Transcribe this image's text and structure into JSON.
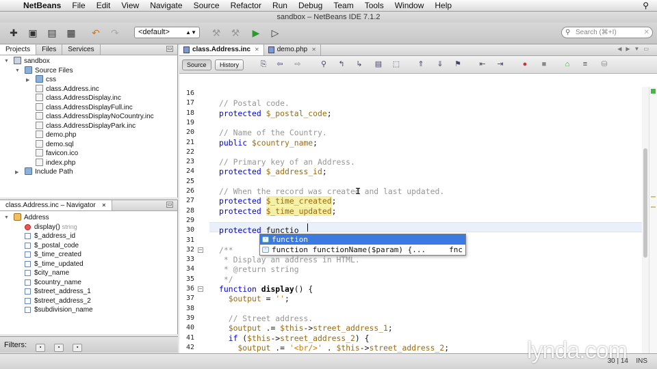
{
  "menubar": {
    "app": "NetBeans",
    "items": [
      "File",
      "Edit",
      "View",
      "Navigate",
      "Source",
      "Refactor",
      "Run",
      "Debug",
      "Team",
      "Tools",
      "Window",
      "Help"
    ]
  },
  "window": {
    "title": "sandbox – NetBeans IDE 7.1.2"
  },
  "toolbar": {
    "config_value": "<default>",
    "search_placeholder": "Search (⌘+I)"
  },
  "projects": {
    "tabs": [
      "Projects",
      "Files",
      "Services"
    ],
    "tree": [
      {
        "label": "sandbox",
        "level": 0,
        "icon": "project-icon",
        "expanded": true
      },
      {
        "label": "Source Files",
        "level": 1,
        "icon": "folder-icon",
        "expanded": true
      },
      {
        "label": "css",
        "level": 2,
        "icon": "folder-icon",
        "expanded": false
      },
      {
        "label": "class.Address.inc",
        "level": 2,
        "icon": "file-icon"
      },
      {
        "label": "class.AddressDisplay.inc",
        "level": 2,
        "icon": "file-icon"
      },
      {
        "label": "class.AddressDisplayFull.inc",
        "level": 2,
        "icon": "file-icon"
      },
      {
        "label": "class.AddressDisplayNoCountry.inc",
        "level": 2,
        "icon": "file-icon"
      },
      {
        "label": "class.AddressDisplayPark.inc",
        "level": 2,
        "icon": "file-icon"
      },
      {
        "label": "demo.php",
        "level": 2,
        "icon": "file-icon"
      },
      {
        "label": "demo.sql",
        "level": 2,
        "icon": "file-icon"
      },
      {
        "label": "favicon.ico",
        "level": 2,
        "icon": "file-icon"
      },
      {
        "label": "index.php",
        "level": 2,
        "icon": "file-icon"
      },
      {
        "label": "Include Path",
        "level": 1,
        "icon": "folder-icon",
        "expanded": false
      }
    ]
  },
  "navigator": {
    "title": "class.Address.inc – Navigator",
    "class": "Address",
    "members": [
      {
        "label": "display()",
        "type": "string",
        "kind": "method"
      },
      {
        "label": "$_address_id",
        "kind": "field"
      },
      {
        "label": "$_postal_code",
        "kind": "field"
      },
      {
        "label": "$_time_created",
        "kind": "field"
      },
      {
        "label": "$_time_updated",
        "kind": "field"
      },
      {
        "label": "$city_name",
        "kind": "field"
      },
      {
        "label": "$country_name",
        "kind": "field"
      },
      {
        "label": "$street_address_1",
        "kind": "field"
      },
      {
        "label": "$street_address_2",
        "kind": "field"
      },
      {
        "label": "$subdivision_name",
        "kind": "field"
      }
    ]
  },
  "filters": {
    "label": "Filters:"
  },
  "editor": {
    "tabs": [
      {
        "label": "class.Address.inc",
        "active": true
      },
      {
        "label": "demo.php",
        "active": false
      }
    ],
    "source_label": "Source",
    "history_label": "History",
    "lines": [
      {
        "n": "16",
        "code": []
      },
      {
        "n": "17",
        "code": [
          [
            "cm",
            "// Postal code."
          ]
        ]
      },
      {
        "n": "18",
        "code": [
          [
            "kw",
            "protected "
          ],
          [
            "vr",
            "$_postal_code"
          ],
          [
            "",
            "; "
          ]
        ]
      },
      {
        "n": "19",
        "code": []
      },
      {
        "n": "20",
        "code": [
          [
            "cm",
            "// Name of the Country."
          ]
        ]
      },
      {
        "n": "21",
        "code": [
          [
            "kw",
            "public "
          ],
          [
            "vr",
            "$country_name"
          ],
          [
            "",
            ";"
          ]
        ]
      },
      {
        "n": "22",
        "code": []
      },
      {
        "n": "23",
        "code": [
          [
            "cm",
            "// Primary key of an Address."
          ]
        ]
      },
      {
        "n": "24",
        "code": [
          [
            "kw",
            "protected "
          ],
          [
            "vr",
            "$_address_id"
          ],
          [
            "",
            ";"
          ]
        ]
      },
      {
        "n": "25",
        "code": []
      },
      {
        "n": "26",
        "code": [
          [
            "cm",
            "// When the record was created and last updated."
          ]
        ]
      },
      {
        "n": "27",
        "code": [
          [
            "kw",
            "protected "
          ],
          [
            "vr hl",
            "$_time_created"
          ],
          [
            "",
            ";"
          ]
        ]
      },
      {
        "n": "28",
        "code": [
          [
            "kw",
            "protected "
          ],
          [
            "vr hl",
            "$_time_updated"
          ],
          [
            "",
            ";"
          ]
        ]
      },
      {
        "n": "29",
        "code": []
      },
      {
        "n": "30",
        "code": [
          [
            "kw",
            "protected "
          ],
          [
            "",
            "functio"
          ]
        ]
      },
      {
        "n": "31",
        "code": []
      },
      {
        "n": "32",
        "code": [
          [
            "cm",
            "/**"
          ]
        ]
      },
      {
        "n": "33",
        "code": [
          [
            "cm",
            " * Display an address in HTML."
          ]
        ]
      },
      {
        "n": "34",
        "code": [
          [
            "cm",
            " * @return string"
          ]
        ]
      },
      {
        "n": "35",
        "code": [
          [
            "cm",
            " */"
          ]
        ]
      },
      {
        "n": "36",
        "code": [
          [
            "kw",
            "function "
          ],
          [
            "fn",
            "display"
          ],
          [
            "",
            "() {"
          ]
        ]
      },
      {
        "n": "37",
        "code": [
          [
            "",
            "  "
          ],
          [
            "vr",
            "$output"
          ],
          [
            "",
            " = "
          ],
          [
            "st",
            "''"
          ],
          [
            "",
            ";"
          ]
        ]
      },
      {
        "n": "38",
        "code": []
      },
      {
        "n": "39",
        "code": [
          [
            "",
            "  "
          ],
          [
            "cm",
            "// Street address."
          ]
        ]
      },
      {
        "n": "40",
        "code": [
          [
            "",
            "  "
          ],
          [
            "vr",
            "$output"
          ],
          [
            "",
            " .= "
          ],
          [
            "vr",
            "$this"
          ],
          [
            "",
            "->"
          ],
          [
            "vr",
            "street_address_1"
          ],
          [
            "",
            ";"
          ]
        ]
      },
      {
        "n": "41",
        "code": [
          [
            "",
            "  "
          ],
          [
            "kw",
            "if"
          ],
          [
            "",
            " ("
          ],
          [
            "vr",
            "$this"
          ],
          [
            "",
            "->"
          ],
          [
            "vr",
            "street_address_2"
          ],
          [
            "",
            ") {"
          ]
        ]
      },
      {
        "n": "42",
        "code": [
          [
            "",
            "    "
          ],
          [
            "vr",
            "$output"
          ],
          [
            "",
            " .= "
          ],
          [
            "st",
            "'<br/>'"
          ],
          [
            "",
            " . "
          ],
          [
            "vr",
            "$this"
          ],
          [
            "",
            "->"
          ],
          [
            "vr",
            "street_address_2"
          ],
          [
            "",
            ";"
          ]
        ]
      }
    ],
    "autocomplete": [
      {
        "label": "function",
        "desc": "",
        "selected": true
      },
      {
        "label": "function functionName($param) {...",
        "desc": "fnc",
        "selected": false
      }
    ]
  },
  "status": {
    "position": "30 | 14",
    "mode": "INS"
  },
  "watermark": "lynda.com"
}
